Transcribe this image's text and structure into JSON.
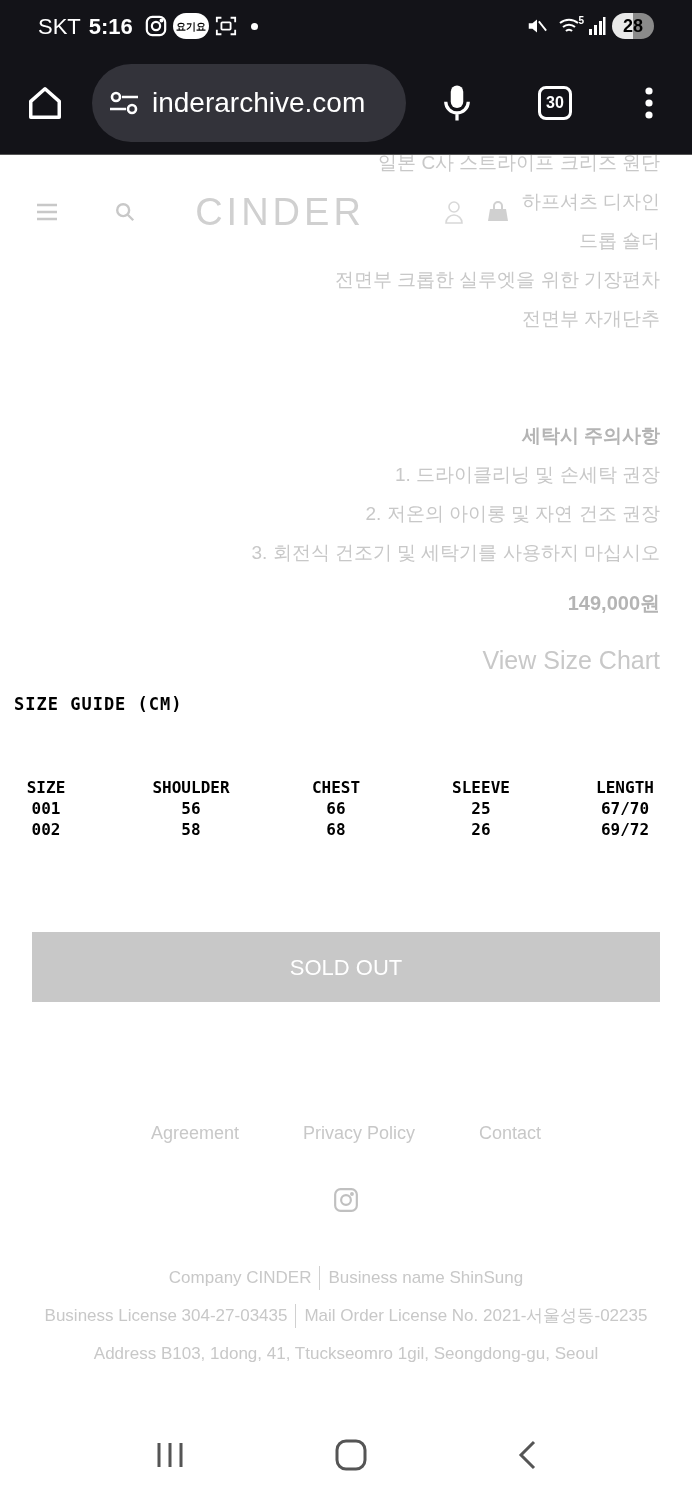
{
  "status_bar": {
    "carrier": "SKT",
    "time": "5:16",
    "badge": "요기요",
    "network": "5",
    "battery": "28"
  },
  "browser": {
    "url": "inderarchive.com",
    "tab_count": "30"
  },
  "header": {
    "logo": "CINDER"
  },
  "description": [
    "일본 C사 스트라이프 크리즈 원단",
    "하프셔츠 디자인",
    "드롭 숄더",
    "전면부 크롭한 실루엣을 위한 기장편차",
    "전면부 자개단추"
  ],
  "care": {
    "heading": "세탁시 주의사항",
    "items": [
      "1. 드라이클리닝 및 손세탁 권장",
      "2. 저온의 아이롱 및 자연 건조 권장",
      "3. 회전식 건조기 및 세탁기를 사용하지 마십시오"
    ]
  },
  "price": "149,000원",
  "size_chart_link": "View Size Chart",
  "size_guide": {
    "title": "SIZE GUIDE (CM)",
    "columns": [
      "SIZE",
      "SHOULDER",
      "CHEST",
      "SLEEVE",
      "LENGTH"
    ],
    "rows": [
      [
        "001",
        "56",
        "66",
        "25",
        "67/70"
      ],
      [
        "002",
        "58",
        "68",
        "26",
        "69/72"
      ]
    ]
  },
  "sold_out_button": {
    "label": "SOLD OUT",
    "disabled": true
  },
  "footer": {
    "links": [
      "Agreement",
      "Privacy Policy",
      "Contact"
    ],
    "info": [
      [
        "Company CINDER",
        "Business name ShinSung"
      ],
      [
        "Business License 304-27-03435",
        "Mail Order License No. 2021-서울성동-02235"
      ],
      [
        "Address B103, 1dong, 41, Ttuckseomro 1gil, Seongdong-gu, Seoul"
      ]
    ]
  }
}
